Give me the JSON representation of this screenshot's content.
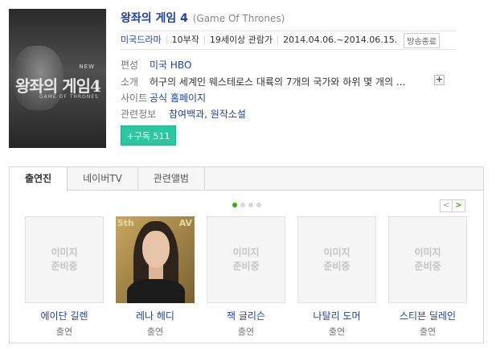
{
  "show": {
    "title": "왕좌의 게임 4",
    "original_title": "(Game Of Thrones)",
    "poster": {
      "logo_new": "NEW",
      "logo_title": "왕좌의 게임4",
      "logo_sub": "GAME OF THRONES"
    }
  },
  "meta": {
    "genre": "미국드라마",
    "episodes": "10부작",
    "rating": "19세이상 관람가",
    "period": "2014.04.06.~2014.06.15.",
    "status_badge": "방송종료"
  },
  "fields": [
    {
      "label": "편성",
      "value": "미국 HBO"
    },
    {
      "label": "소개",
      "value": "허구의 세계인 웨스테로스 대륙의 7개의 국가와 하위 몇 개의 ..."
    },
    {
      "label": "사이트",
      "value": "공식 홈페이지"
    },
    {
      "label": "관련정보",
      "value": "참여백과, 원작소설"
    }
  ],
  "expand_label": "+",
  "subscribe": {
    "label": "+구독 511"
  },
  "tabs": [
    {
      "label": "출연진",
      "active": true
    },
    {
      "label": "네이버TV",
      "active": false
    },
    {
      "label": "관련앨범",
      "active": false
    }
  ],
  "carousel": {
    "pages": 4,
    "current_page": 1,
    "prev_label": "<",
    "next_label": ">"
  },
  "no_image_text": "이미지\n준비중",
  "cast": [
    {
      "name": "에이단 길렌",
      "role": "출연",
      "has_photo": false
    },
    {
      "name": "레나 헤디",
      "role": "출연",
      "has_photo": true,
      "photo_bg_text_left": "5th",
      "photo_bg_text_right": "AV"
    },
    {
      "name": "잭 글리슨",
      "role": "출연",
      "has_photo": false
    },
    {
      "name": "나탈리 도머",
      "role": "출연",
      "has_photo": false
    },
    {
      "name": "스티븐 딜레인",
      "role": "출연",
      "has_photo": false
    }
  ],
  "colors": {
    "link": "#1f41aa",
    "subscribe": "#2bc7a0",
    "active_dot": "#2db400"
  }
}
